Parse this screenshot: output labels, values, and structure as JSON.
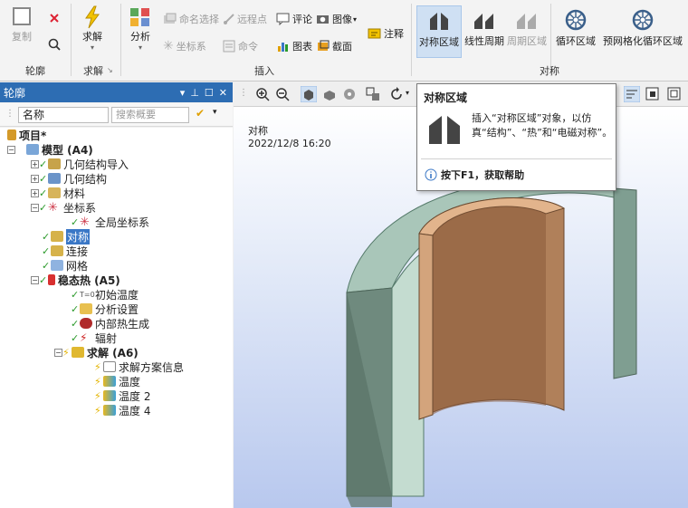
{
  "ribbon": {
    "groups": {
      "outline": "轮廓",
      "solve": "求解",
      "insert": "插入",
      "symmetry": "对称"
    },
    "copy": "复制",
    "solve_btn": "求解",
    "analysis": "分析",
    "named_selection": "命名选择",
    "remote_point": "远程点",
    "comment": "评论",
    "image": "图像",
    "coordinate_system": "坐标系",
    "command": "命令",
    "chart": "图表",
    "section": "截面",
    "annotation": "注释",
    "symmetry_region": "对称区域",
    "linear_periodic": "线性周期",
    "periodic_region": "周期区域",
    "cyclic_region": "循环区域",
    "pre_mesh_cyclic": "预网格化循环区域"
  },
  "outline": {
    "title": "轮廓",
    "filter_label": "名称",
    "search_placeholder": "搜索概要",
    "tree": {
      "project": "项目*",
      "model": "模型 (A4)",
      "geometry_import": "几何结构导入",
      "geometry": "几何结构",
      "materials": "材料",
      "coordinate_systems": "坐标系",
      "global_cs": "全局坐标系",
      "symmetry": "对称",
      "connections": "连接",
      "mesh": "网格",
      "steady_thermal": "稳态热 (A5)",
      "initial_temp": "初始温度",
      "analysis_settings": "分析设置",
      "internal_heat": "内部热生成",
      "radiation": "辐射",
      "solution": "求解 (A6)",
      "solution_info": "求解方案信息",
      "temp1": "温度",
      "temp2": "温度 2",
      "temp4": "温度 4"
    }
  },
  "viewport": {
    "title": "对称",
    "date": "2022/12/8 16:20"
  },
  "tooltip": {
    "title": "对称区域",
    "text": "插入“对称区域”对象，以仿真“结构”、“热”和“电磁对称”。",
    "help": "按下F1，获取帮助"
  },
  "colors": {
    "accent": "#2d6db3",
    "outer_shell": "#8fb0a3",
    "inner_core": "#c9976b"
  }
}
